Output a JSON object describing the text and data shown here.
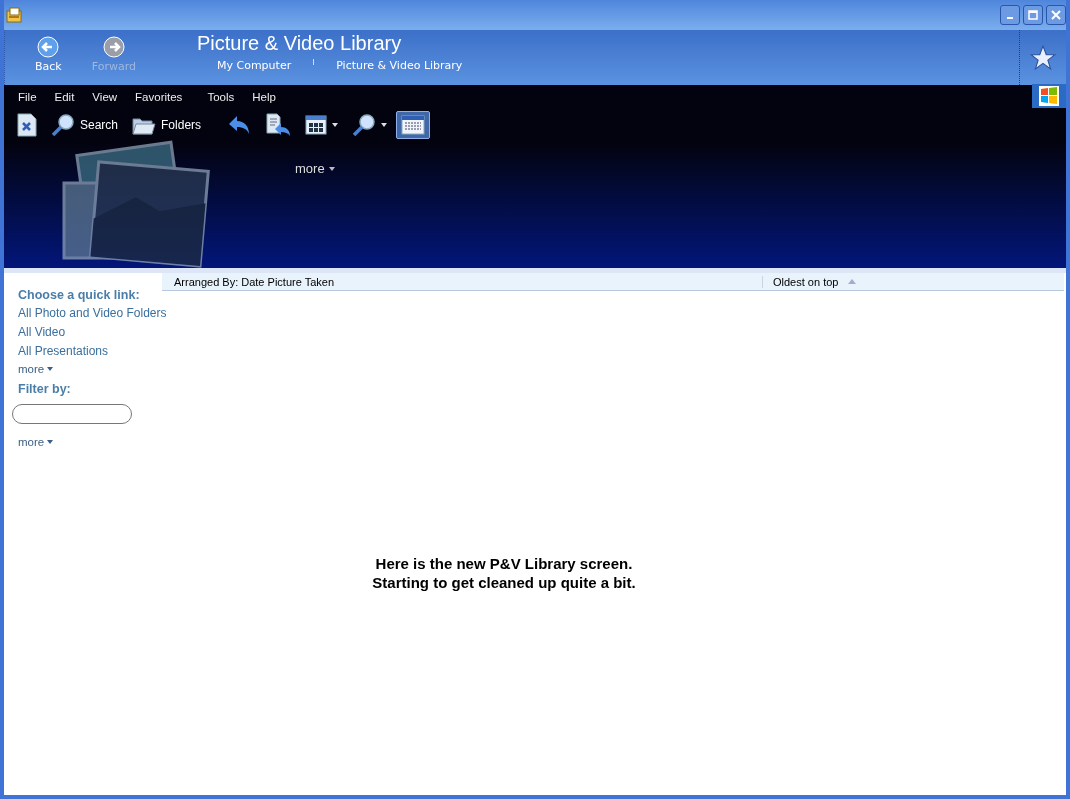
{
  "window": {
    "title": "Picture & Video Library"
  },
  "nav": [
    {
      "label": "Back",
      "disabled": false
    },
    {
      "label": "Forward",
      "disabled": true
    }
  ],
  "breadcrumb": [
    "My Computer",
    "Picture & Video Library"
  ],
  "menu": [
    "File",
    "Edit",
    "View",
    "Favorites",
    "Tools",
    "Help"
  ],
  "toolbar": [
    {
      "dropdown": false,
      "selected": false
    },
    {
      "label": "Search",
      "dropdown": false,
      "selected": false
    },
    {
      "label": "Folders",
      "dropdown": false,
      "selected": false
    },
    {
      "dropdown": false,
      "selected": false
    },
    {
      "dropdown": false,
      "selected": false
    },
    {
      "dropdown": true,
      "selected": false
    },
    {
      "dropdown": true,
      "selected": false
    },
    {
      "dropdown": false,
      "selected": true
    }
  ],
  "banner": {
    "more": "more"
  },
  "sort_bar": {
    "arranged_by": "Arranged By: Date Picture Taken",
    "order": "Oldest on top"
  },
  "sidebar": {
    "quick_link_heading": "Choose a quick link:",
    "quick_links": [
      "All Photo and Video Folders",
      "All Video",
      "All Presentations"
    ],
    "more": "more",
    "filter_heading": "Filter by:",
    "filter_more": "more"
  },
  "message": [
    "Here is the new P&V Library screen.",
    "Starting to get cleaned up quite a bit."
  ]
}
